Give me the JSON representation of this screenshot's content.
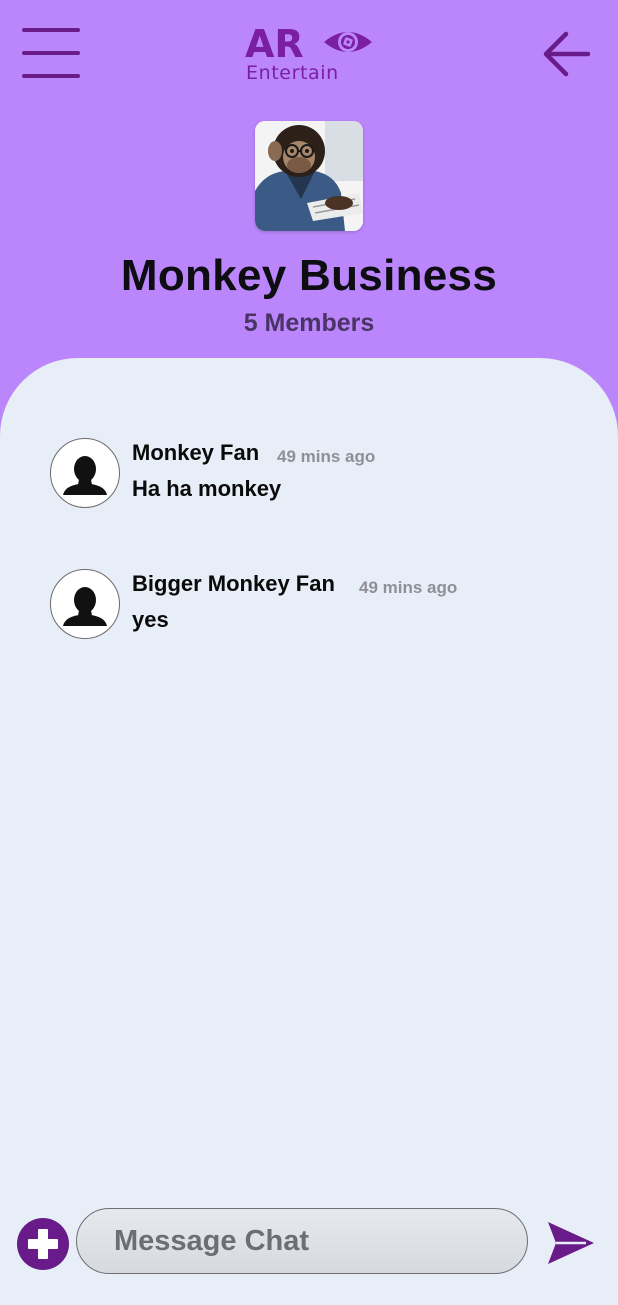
{
  "header": {
    "menu_icon": "hamburger-menu-icon",
    "logo": {
      "line1": "AR",
      "line2": "Entertain"
    },
    "back_icon": "arrow-left-icon",
    "group_name": "Monkey Business",
    "members": "5 Members"
  },
  "messages": [
    {
      "author": "Monkey Fan",
      "time": "49 mins ago",
      "text": "Ha ha monkey"
    },
    {
      "author": "Bigger Monkey Fan",
      "time": "49 mins ago",
      "text": "yes"
    }
  ],
  "composer": {
    "add_icon": "plus-icon",
    "placeholder": "Message Chat",
    "send_icon": "send-icon"
  },
  "colors": {
    "header_bg": "#bb86fc",
    "accent": "#6a1b8a",
    "panel_bg": "#e7eef7"
  }
}
